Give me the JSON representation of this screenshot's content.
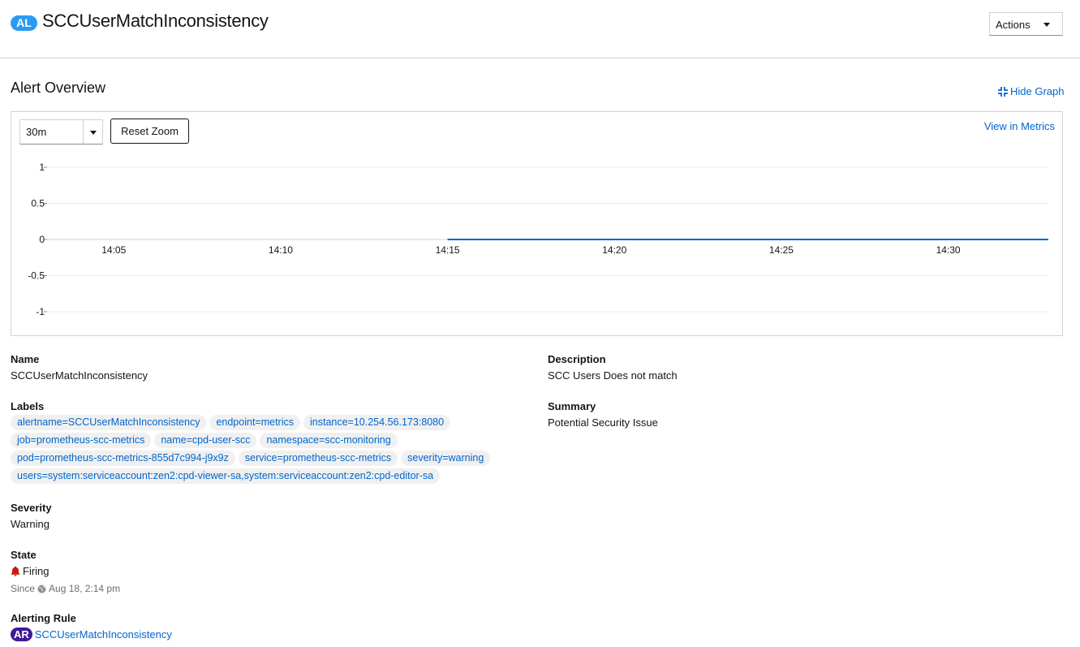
{
  "header": {
    "badge": "AL",
    "title": "SCCUserMatchInconsistency",
    "actions_label": "Actions"
  },
  "overview": {
    "title": "Alert Overview",
    "hide_graph_label": "Hide Graph",
    "view_in_metrics_label": "View in Metrics",
    "time_range_value": "30m",
    "reset_zoom_label": "Reset Zoom"
  },
  "chart_data": {
    "type": "line",
    "x_ticks": [
      "14:05",
      "14:10",
      "14:15",
      "14:20",
      "14:25",
      "14:30"
    ],
    "y_ticks": [
      "1",
      "0.5",
      "0",
      "-0.5",
      "-1"
    ],
    "ylim": [
      -1,
      1
    ],
    "xlim": [
      "14:03",
      "14:33"
    ],
    "series": [
      {
        "color": "#06c",
        "points": [
          [
            "14:15",
            0
          ],
          [
            "14:33",
            0
          ]
        ]
      }
    ]
  },
  "details": {
    "name_label": "Name",
    "name_value": "SCCUserMatchInconsistency",
    "labels_label": "Labels",
    "labels": [
      "alertname=SCCUserMatchInconsistency",
      "endpoint=metrics",
      "instance=10.254.56.173:8080",
      "job=prometheus-scc-metrics",
      "name=cpd-user-scc",
      "namespace=scc-monitoring",
      "pod=prometheus-scc-metrics-855d7c994-j9x9z",
      "service=prometheus-scc-metrics",
      "severity=warning",
      "users=system:serviceaccount:zen2:cpd-viewer-sa,system:serviceaccount:zen2:cpd-editor-sa"
    ],
    "severity_label": "Severity",
    "severity_value": "Warning",
    "state_label": "State",
    "state_value": "Firing",
    "since_prefix": "Since",
    "since_value": "Aug 18, 2:14 pm",
    "alerting_rule_label": "Alerting Rule",
    "alerting_rule_badge": "AR",
    "alerting_rule_value": "SCCUserMatchInconsistency",
    "description_label": "Description",
    "description_value": "SCC Users Does not match",
    "summary_label": "Summary",
    "summary_value": "Potential Security Issue"
  },
  "colors": {
    "link": "#06c",
    "badge_al": "#2b9af3",
    "badge_ar": "#40199a",
    "firing_bell": "#c9190b"
  }
}
